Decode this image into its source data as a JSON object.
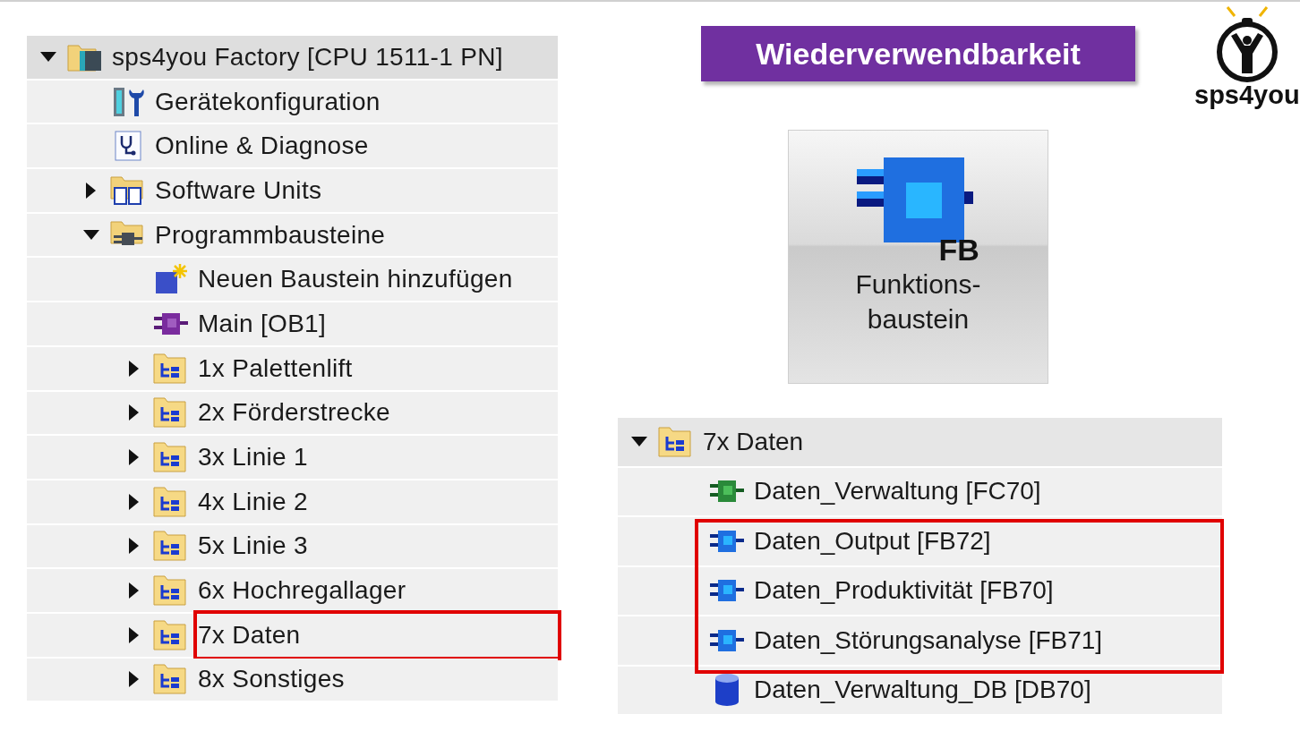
{
  "project_tree": {
    "label": "sps4you Factory [CPU 1511-1 PN]",
    "kind": "device",
    "expanded": true,
    "highlighted": false,
    "children": [
      {
        "label": "Gerätekonfiguration",
        "kind": "config",
        "highlighted": false
      },
      {
        "label": "Online & Diagnose",
        "kind": "diagnose",
        "highlighted": false
      },
      {
        "label": "Software Units",
        "kind": "units-folder",
        "expanded": false,
        "highlighted": false
      },
      {
        "label": "Programmbausteine",
        "kind": "blocks-folder",
        "expanded": true,
        "highlighted": false,
        "children": [
          {
            "label": "Neuen Baustein hinzufügen",
            "kind": "add-block",
            "highlighted": false
          },
          {
            "label": "Main [OB1]",
            "kind": "ob",
            "highlighted": false
          },
          {
            "label": "1x Palettenlift",
            "kind": "group-folder",
            "expanded": false,
            "highlighted": false
          },
          {
            "label": "2x Förderstrecke",
            "kind": "group-folder",
            "expanded": false,
            "highlighted": false
          },
          {
            "label": "3x Linie 1",
            "kind": "group-folder",
            "expanded": false,
            "highlighted": false
          },
          {
            "label": "4x Linie 2",
            "kind": "group-folder",
            "expanded": false,
            "highlighted": false
          },
          {
            "label": "5x Linie 3",
            "kind": "group-folder",
            "expanded": false,
            "highlighted": false
          },
          {
            "label": "6x Hochregallager",
            "kind": "group-folder",
            "expanded": false,
            "highlighted": false
          },
          {
            "label": "7x Daten",
            "kind": "group-folder",
            "expanded": false,
            "highlighted": true
          },
          {
            "label": "8x Sonstiges",
            "kind": "group-folder",
            "expanded": false,
            "highlighted": false
          }
        ]
      }
    ]
  },
  "banner": {
    "title": "Wiederverwendbarkeit"
  },
  "logo": {
    "text": "sps4you"
  },
  "block_button": {
    "icon_label": "FB",
    "label_lines": [
      "Funktions-",
      "baustein"
    ]
  },
  "detail_tree": {
    "label": "7x Daten",
    "kind": "group-folder",
    "expanded": true,
    "children": [
      {
        "label": "Daten_Verwaltung [FC70]",
        "kind": "fc",
        "highlighted": false
      },
      {
        "label": "Daten_Output [FB72]",
        "kind": "fb",
        "highlighted": true
      },
      {
        "label": "Daten_Produktivität [FB70]",
        "kind": "fb",
        "highlighted": true
      },
      {
        "label": "Daten_Störungsanalyse [FB71]",
        "kind": "fb",
        "highlighted": true
      },
      {
        "label": "Daten_Verwaltung_DB [DB70]",
        "kind": "db",
        "highlighted": false
      }
    ]
  }
}
